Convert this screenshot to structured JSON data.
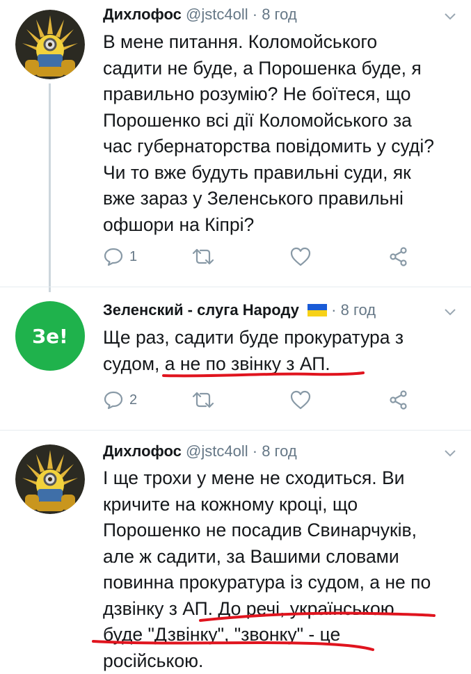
{
  "tweets": [
    {
      "name": "Дихлофос",
      "handle": "@jstc4oll",
      "dot": "·",
      "time": "8 год",
      "lines": [
        "В мене питання. Коломойського",
        "садити не буде, а Порошенка буде, я",
        "правильно розумію? Не боїтеся, що",
        "Порошенко всі дії Коломойського за",
        "час губернаторства повідомить у суді?",
        "Чи то вже будуть правильні суди, як",
        "вже зараз у Зеленського правильні",
        "офшори на Кіпрі?"
      ],
      "reply_count": "1",
      "avatar_icon": "golden-throne-minion-avatar"
    },
    {
      "name": "Зеленский - слуга Народу",
      "handle": "",
      "dot": "·",
      "time": "8 год",
      "lines": [
        "Ще раз, садити буде прокуратура з",
        "судом, а не по звінку з АП."
      ],
      "reply_count": "2",
      "avatar_text": "Зе!",
      "avatar_color": "#1fb24c"
    },
    {
      "name": "Дихлофос",
      "handle": "@jstc4oll",
      "dot": "·",
      "time": "8 год",
      "lines": [
        "І ще трохи у мене не сходиться. Ви",
        "кричите на кожному кроці, що",
        "Порошенко не посадив Свинарчуків,",
        "але ж садити, за Вашими словами",
        "повинна прокуратура із судом, а не по",
        "дзвінку з АП. До речі, українською",
        "буде \"Дзвінку\", \"звонку\" - це",
        "російською."
      ],
      "avatar_icon": "golden-throne-minion-avatar"
    }
  ],
  "icons": {
    "reply": "reply-icon",
    "retweet": "retweet-icon",
    "like": "heart-icon",
    "share": "share-icon",
    "caret": "chevron-down-icon",
    "flag": "ukraine-flag-icon"
  },
  "colors": {
    "text": "#14171a",
    "muted": "#657786",
    "annotation": "#e0141e",
    "zelensky_green": "#1fb24c",
    "flag_blue": "#1a5bd6",
    "flag_yellow": "#f7d117"
  }
}
